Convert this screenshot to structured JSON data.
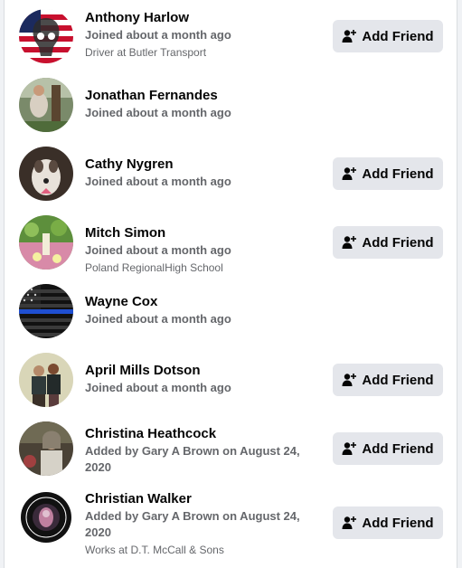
{
  "members": [
    {
      "name": "Anthony Harlow",
      "subtitle": "Joined about a month ago",
      "detail": "Driver at Butler Transport",
      "button": "Add Friend",
      "avatar": "skull-flag-avatar"
    },
    {
      "name": "Jonathan Fernandes",
      "subtitle": "Joined about a month ago",
      "detail": "",
      "button": "",
      "avatar": "outdoor-photo-avatar"
    },
    {
      "name": "Cathy Nygren",
      "subtitle": "Joined about a month ago",
      "detail": "",
      "button": "Add Friend",
      "avatar": "dog-photo-avatar"
    },
    {
      "name": "Mitch Simon",
      "subtitle": "Joined about a month ago",
      "detail": "Poland RegionalHigh School",
      "button": "Add Friend",
      "avatar": "garden-photo-avatar"
    },
    {
      "name": "Wayne Cox",
      "subtitle": "Joined about a month ago",
      "detail": "",
      "button": "",
      "avatar": "thin-blue-line-flag-avatar"
    },
    {
      "name": "April Mills Dotson",
      "subtitle": "Joined about a month ago",
      "detail": "",
      "button": "Add Friend",
      "avatar": "couple-photo-avatar"
    },
    {
      "name": "Christina Heathcock",
      "subtitle": "Added by Gary A Brown on August 24, 2020",
      "detail": "",
      "button": "Add Friend",
      "avatar": "woman-photo-avatar"
    },
    {
      "name": "Christian Walker",
      "subtitle": "Added by Gary A Brown on August 24, 2020",
      "detail": "Works at D.T. McCall & Sons",
      "button": "Add Friend",
      "avatar": "logo-badge-avatar"
    }
  ],
  "colors": {
    "button_bg": "#e4e6eb",
    "text_primary": "#050505",
    "text_secondary": "#65676b"
  },
  "icons": {
    "add_friend": "person-plus-icon"
  }
}
